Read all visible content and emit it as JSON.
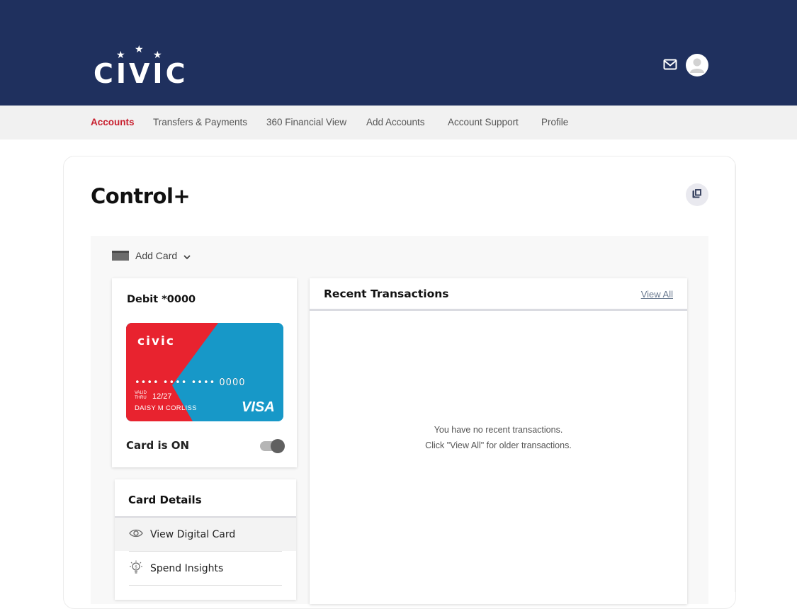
{
  "brand": {
    "logo_text": "CIVIC",
    "card_logo_text": "civic",
    "colors": {
      "header_bg": "#1f305e",
      "accent_red": "#c8202f",
      "card_red": "#e8232f",
      "card_blue": "#1798c8"
    }
  },
  "header": {
    "icons": [
      "mail-icon",
      "user-avatar-icon"
    ]
  },
  "nav": {
    "items": [
      {
        "label": "Accounts",
        "active": true
      },
      {
        "label": "Transfers & Payments",
        "active": false
      },
      {
        "label": "360 Financial View",
        "active": false
      },
      {
        "label": "Add Accounts",
        "active": false
      },
      {
        "label": "Account Support",
        "active": false
      },
      {
        "label": "Profile",
        "active": false
      }
    ]
  },
  "page": {
    "title": "Control+",
    "copy_icon": "copy-icon"
  },
  "add_card": {
    "label": "Add Card",
    "icon": "card-icon",
    "chevron": "chevron-down-icon"
  },
  "debit_card": {
    "title": "Debit *0000",
    "masked_number": "•••• •••• •••• 0000",
    "valid_label_1": "VALID",
    "valid_label_2": "THRU",
    "expiry": "12/27",
    "cardholder": "DAISY M CORLISS",
    "network": "VISA",
    "status_label": "Card is ON",
    "is_on": true
  },
  "card_details": {
    "title": "Card Details",
    "items": [
      {
        "label": "View Digital Card",
        "icon": "eye-icon"
      },
      {
        "label": "Spend Insights",
        "icon": "lightbulb-dollar-icon"
      }
    ]
  },
  "transactions": {
    "title": "Recent Transactions",
    "view_all": "View All",
    "empty_line_1": "You have no recent transactions.",
    "empty_line_2": "Click \"View All\" for older transactions."
  }
}
